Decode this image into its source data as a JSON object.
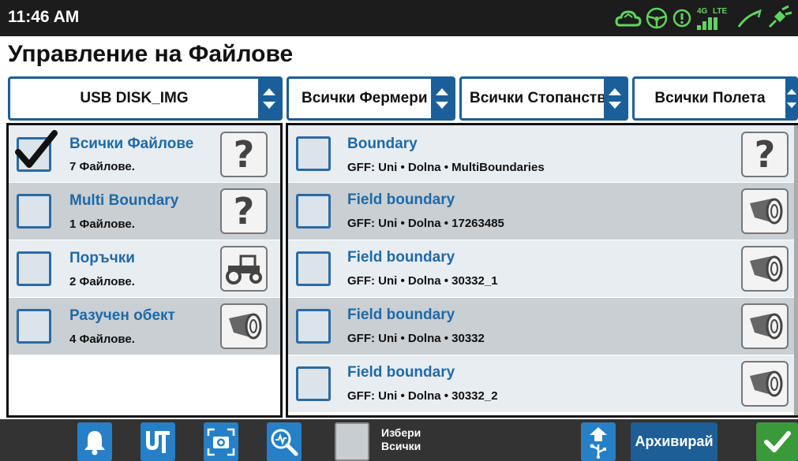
{
  "status": {
    "time": "11:46 AM",
    "network": "4G",
    "lte": "LTE"
  },
  "title": "Управление на Файлове",
  "filters": [
    {
      "label": "USB DISK_IMG"
    },
    {
      "label": "Всички Фермери"
    },
    {
      "label": "Всички Стопанства"
    },
    {
      "label": "Всички Полета"
    }
  ],
  "categories": [
    {
      "name": "Всички Файлове",
      "count": "7 Файлове.",
      "checked": true,
      "icon": "question-icon"
    },
    {
      "name": "Multi Boundary",
      "count": "1 Файлове.",
      "checked": false,
      "icon": "question-icon"
    },
    {
      "name": "Поръчки",
      "count": "2 Файлове.",
      "checked": false,
      "icon": "tractor-icon"
    },
    {
      "name": "Разучен обект",
      "count": "4 Файлове.",
      "checked": false,
      "icon": "roller-icon"
    }
  ],
  "files": [
    {
      "name": "Boundary",
      "info": "GFF:  Uni • Dolna • MultiBoundaries",
      "icon": "question-icon"
    },
    {
      "name": "Field boundary",
      "info": "GFF:  Uni • Dolna • 17263485",
      "icon": "roller-icon"
    },
    {
      "name": "Field boundary",
      "info": "GFF:  Uni • Dolna • 30332_1",
      "icon": "roller-icon"
    },
    {
      "name": "Field boundary",
      "info": "GFF:  Uni • Dolna • 30332",
      "icon": "roller-icon"
    },
    {
      "name": "Field boundary",
      "info": "GFF:  Uni • Dolna • 30332_2",
      "icon": "roller-icon"
    }
  ],
  "bottom": {
    "select_all_line1": "Избери",
    "select_all_line2": "Всички",
    "archive_label": "Архивирай"
  },
  "colors": {
    "accent": "#1a5f9a",
    "link_text": "#1e6aa8",
    "status_green": "#5fd35f",
    "ok_green": "#3a9a3a",
    "bottom_bar": "#333333"
  }
}
